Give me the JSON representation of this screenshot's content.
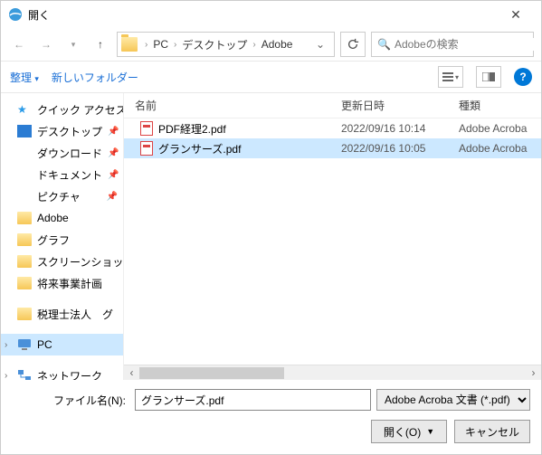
{
  "window": {
    "title": "開く",
    "close": "✕"
  },
  "nav": {
    "path": [
      "PC",
      "デスクトップ",
      "Adobe"
    ],
    "search_placeholder": "Adobeの検索"
  },
  "toolbar": {
    "organize": "整理",
    "newfolder": "新しいフォルダー"
  },
  "sidebar": {
    "quick": "クイック アクセス",
    "pinned": [
      {
        "label": "デスクトップ",
        "icon": "desk"
      },
      {
        "label": "ダウンロード",
        "icon": "dl"
      },
      {
        "label": "ドキュメント",
        "icon": "doc"
      },
      {
        "label": "ピクチャ",
        "icon": "pic"
      }
    ],
    "recent": [
      {
        "label": "Adobe"
      },
      {
        "label": "グラフ"
      },
      {
        "label": "スクリーンショット"
      },
      {
        "label": "将来事業計画"
      }
    ],
    "extra": [
      {
        "label": "税理士法人　グ"
      }
    ],
    "pc": "PC",
    "network": "ネットワーク"
  },
  "columns": {
    "name": "名前",
    "date": "更新日時",
    "type": "種類"
  },
  "files": [
    {
      "name": "PDF経理2.pdf",
      "date": "2022/09/16 10:14",
      "type": "Adobe Acroba"
    },
    {
      "name": "グランサーズ.pdf",
      "date": "2022/09/16 10:05",
      "type": "Adobe Acroba"
    }
  ],
  "selected_index": 1,
  "footer": {
    "filename_label": "ファイル名(N):",
    "filename_value": "グランサーズ.pdf",
    "filter": "Adobe Acroba 文書 (*.pdf)",
    "open": "開く(O)",
    "cancel": "キャンセル"
  }
}
